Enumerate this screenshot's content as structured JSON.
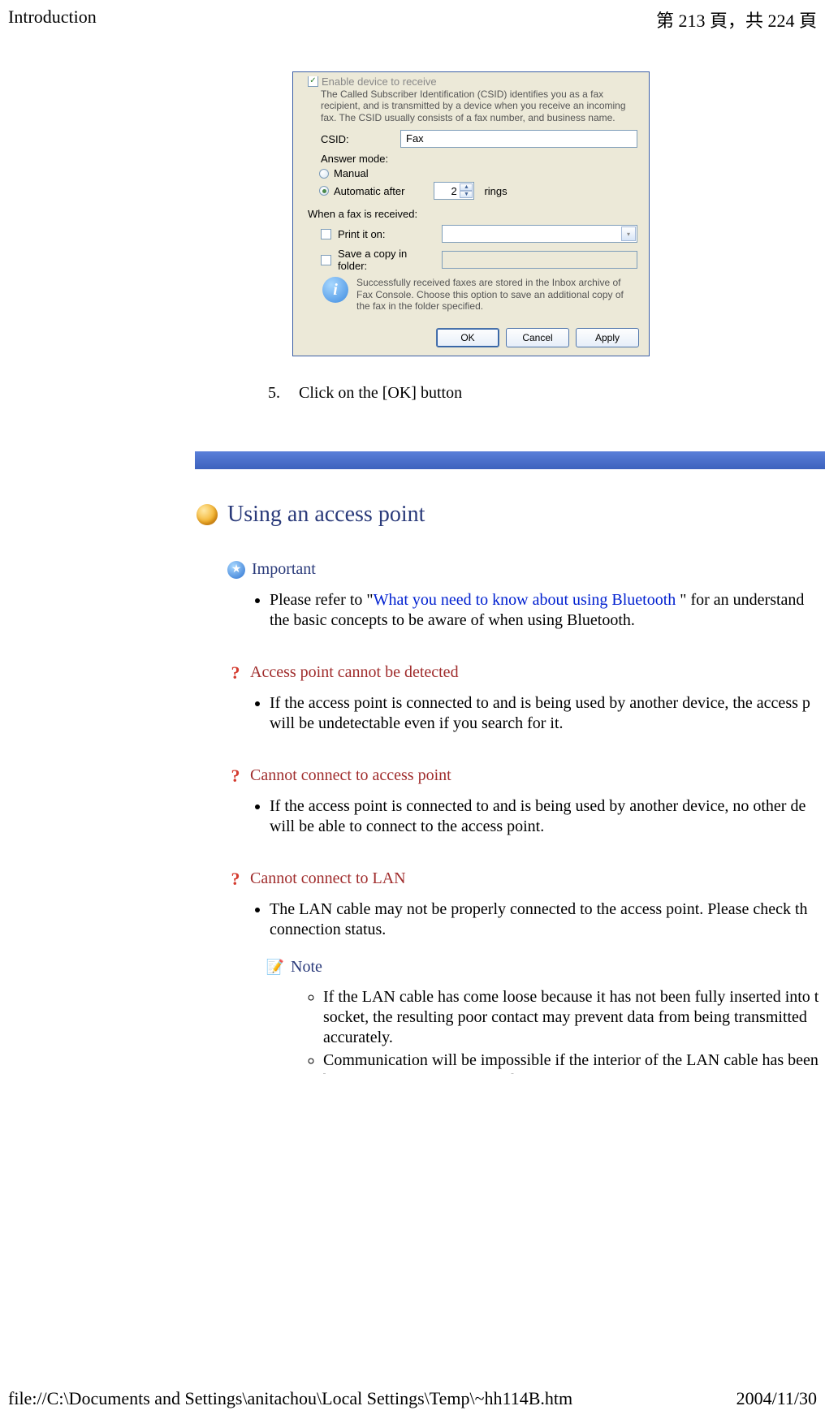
{
  "header": {
    "title": "Introduction",
    "page": "第 213 頁，共 224 頁"
  },
  "dialog": {
    "enable_label": "Enable device to receive",
    "explain": "The Called Subscriber Identification (CSID) identifies you as a fax recipient, and is transmitted by a device when you receive an incoming fax. The CSID usually consists of a fax number, and business name.",
    "csid_label": "CSID:",
    "csid_value": "Fax",
    "answer_mode": "Answer mode:",
    "mode_manual": "Manual",
    "mode_auto": "Automatic after",
    "rings_value": "2",
    "rings_suffix": "rings",
    "received_label": "When a fax is received:",
    "print_on": "Print it on:",
    "save_copy": "Save a copy in folder:",
    "info": "Successfully received faxes are stored in the Inbox archive of Fax Console. Choose this option to save an additional copy of the fax in the folder specified.",
    "ok": "OK",
    "cancel": "Cancel",
    "apply": "Apply"
  },
  "step": {
    "num": "5.",
    "text": "Click on the [OK] button"
  },
  "section": {
    "title": "Using an access point"
  },
  "important": {
    "label": "Important",
    "bullet_pre": "Please refer to \"",
    "bullet_link": "What you need to know about using Bluetooth",
    "bullet_post": " \" for an understand the basic concepts to be aware of when using Bluetooth."
  },
  "qa": [
    {
      "h": "Access point cannot be detected",
      "b": "If the access point is connected to and is being used by another device, the access p will be undetectable even if you search for it."
    },
    {
      "h": "Cannot connect to access point",
      "b": "If the access point is connected to and is being used by another device, no other de will be able to connect to the access point."
    },
    {
      "h": "Cannot connect to LAN",
      "b": "The LAN cable may not be properly connected to the access point. Please check th connection status."
    }
  ],
  "note": {
    "label": "Note",
    "items": [
      "If the LAN cable has come loose because it has not been fully inserted into t socket, the resulting poor contact may prevent data from being transmitted accurately.",
      "Communication will be impossible if the interior of the LAN cable has been broken. Please replace the cable with another one."
    ]
  },
  "footer": {
    "path": "file://C:\\Documents and Settings\\anitachou\\Local Settings\\Temp\\~hh114B.htm",
    "date": "2004/11/30"
  }
}
